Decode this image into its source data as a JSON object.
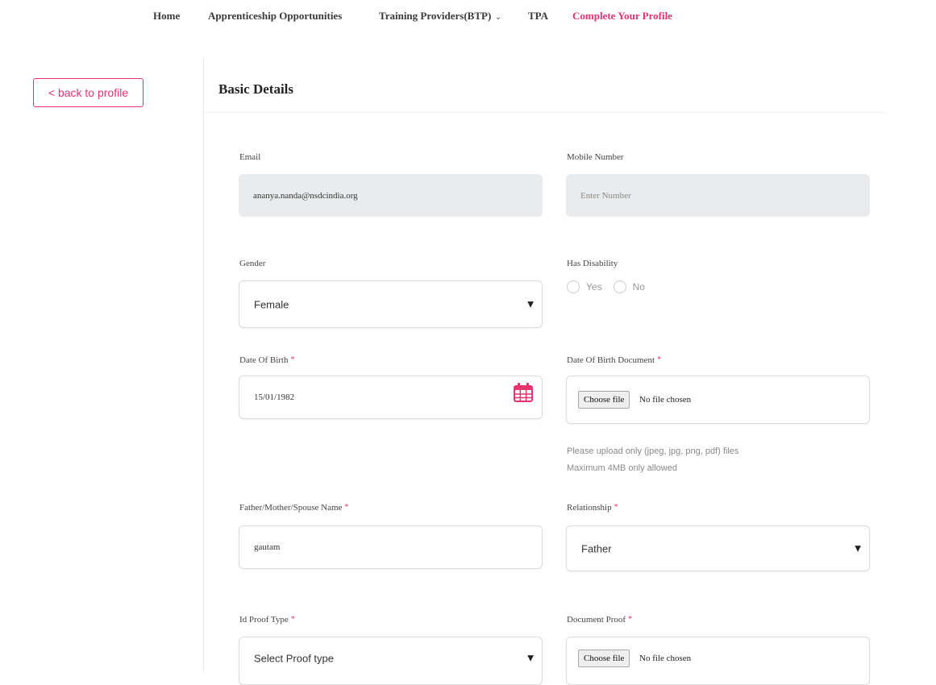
{
  "nav": {
    "home": "Home",
    "apprenticeship": "Apprenticeship Opportunities",
    "training_providers": "Training Providers(BTP)",
    "tpa": "TPA",
    "complete_profile": "Complete Your Profile"
  },
  "back_button": "< back to profile",
  "section_title": "Basic Details",
  "form": {
    "email": {
      "label": "Email",
      "value": "ananya.nanda@nsdcindia.org"
    },
    "mobile": {
      "label": "Mobile Number",
      "placeholder": "Enter Number"
    },
    "gender": {
      "label": "Gender",
      "value": "Female"
    },
    "disability": {
      "label": "Has Disability",
      "options": [
        "Yes",
        "No"
      ]
    },
    "dob": {
      "label": "Date Of Birth",
      "value": "15/01/1982"
    },
    "dob_doc": {
      "label": "Date Of Birth Document",
      "button": "Choose file",
      "status": "No file chosen",
      "hint1": "Please upload only (jpeg, jpg, png, pdf) files",
      "hint2": "Maximum 4MB only allowed"
    },
    "parent_name": {
      "label": "Father/Mother/Spouse Name",
      "value": "gautam"
    },
    "relationship": {
      "label": "Relationship",
      "value": "Father"
    },
    "id_proof_type": {
      "label": "Id Proof Type",
      "value": "Select Proof type"
    },
    "document_proof": {
      "label": "Document Proof",
      "button": "Choose file",
      "status": "No file chosen"
    },
    "required_mark": "*"
  },
  "colors": {
    "accent": "#e8336d",
    "input_disabled": "#e9ebed"
  },
  "icons": {
    "calendar": "calendar-icon",
    "dropdown": "caret-down-icon"
  }
}
